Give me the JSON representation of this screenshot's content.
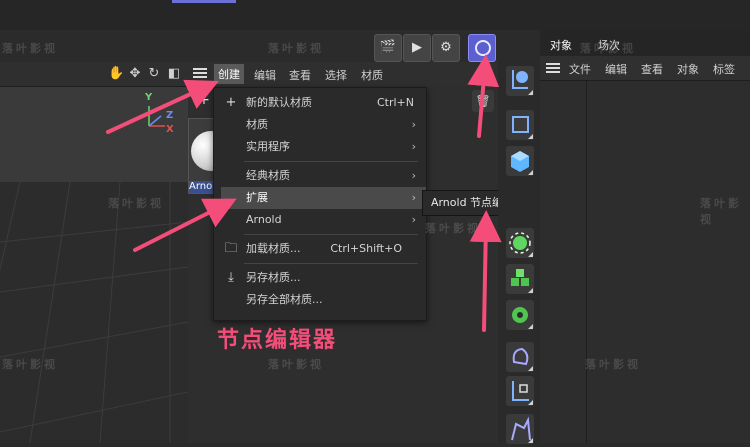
{
  "menubar": {
    "items": [
      "创建",
      "编辑",
      "查看",
      "选择",
      "材质"
    ],
    "active": "创建"
  },
  "dropdown": {
    "items": [
      {
        "label": "新的默认材质",
        "shortcut": "Ctrl+N",
        "icon": "plus-icon",
        "submenu": false
      },
      {
        "label": "材质",
        "shortcut": "",
        "icon": "",
        "submenu": true
      },
      {
        "label": "实用程序",
        "shortcut": "",
        "icon": "",
        "submenu": true
      },
      {
        "label": "经典材质",
        "shortcut": "",
        "icon": "",
        "submenu": true
      },
      {
        "label": "扩展",
        "shortcut": "",
        "icon": "",
        "submenu": true,
        "highlighted": true
      },
      {
        "label": "Arnold",
        "shortcut": "",
        "icon": "",
        "submenu": true
      },
      {
        "label": "加载材质...",
        "shortcut": "Ctrl+Shift+O",
        "icon": "folder-icon",
        "submenu": false
      },
      {
        "label": "另存材质...",
        "shortcut": "",
        "icon": "download-icon",
        "submenu": false
      },
      {
        "label": "另存全部材质...",
        "shortcut": "",
        "icon": "",
        "submenu": false
      }
    ]
  },
  "submenu": {
    "label": "Arnold 节点编辑器"
  },
  "material_thumb": {
    "name": "Arno"
  },
  "object_panel": {
    "tabs": [
      "对象",
      "场次"
    ],
    "menu": [
      "文件",
      "编辑",
      "查看",
      "对象",
      "标签"
    ]
  },
  "viewport": {
    "axes": {
      "y": "Y",
      "z": "Z",
      "x": "X"
    }
  },
  "annotation": {
    "text": "节点编辑器",
    "color": "#f54d7a"
  },
  "watermark": {
    "text": "落叶影视"
  },
  "colors": {
    "accent": "#5b5fd0",
    "highlight": "#4a4a4a",
    "arrow": "#f54d7a"
  }
}
